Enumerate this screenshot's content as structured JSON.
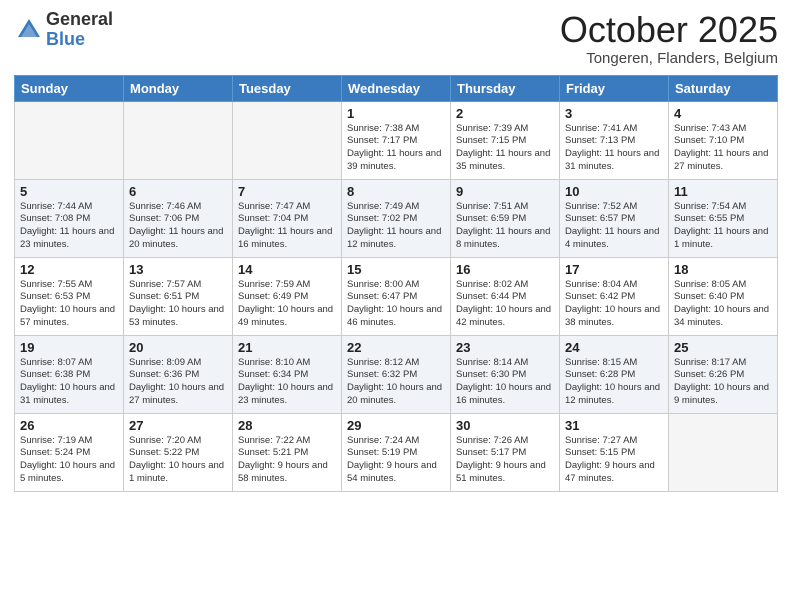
{
  "header": {
    "logo_general": "General",
    "logo_blue": "Blue",
    "month": "October 2025",
    "location": "Tongeren, Flanders, Belgium"
  },
  "days_of_week": [
    "Sunday",
    "Monday",
    "Tuesday",
    "Wednesday",
    "Thursday",
    "Friday",
    "Saturday"
  ],
  "weeks": [
    [
      {
        "day": "",
        "info": ""
      },
      {
        "day": "",
        "info": ""
      },
      {
        "day": "",
        "info": ""
      },
      {
        "day": "1",
        "info": "Sunrise: 7:38 AM\nSunset: 7:17 PM\nDaylight: 11 hours\nand 39 minutes."
      },
      {
        "day": "2",
        "info": "Sunrise: 7:39 AM\nSunset: 7:15 PM\nDaylight: 11 hours\nand 35 minutes."
      },
      {
        "day": "3",
        "info": "Sunrise: 7:41 AM\nSunset: 7:13 PM\nDaylight: 11 hours\nand 31 minutes."
      },
      {
        "day": "4",
        "info": "Sunrise: 7:43 AM\nSunset: 7:10 PM\nDaylight: 11 hours\nand 27 minutes."
      }
    ],
    [
      {
        "day": "5",
        "info": "Sunrise: 7:44 AM\nSunset: 7:08 PM\nDaylight: 11 hours\nand 23 minutes."
      },
      {
        "day": "6",
        "info": "Sunrise: 7:46 AM\nSunset: 7:06 PM\nDaylight: 11 hours\nand 20 minutes."
      },
      {
        "day": "7",
        "info": "Sunrise: 7:47 AM\nSunset: 7:04 PM\nDaylight: 11 hours\nand 16 minutes."
      },
      {
        "day": "8",
        "info": "Sunrise: 7:49 AM\nSunset: 7:02 PM\nDaylight: 11 hours\nand 12 minutes."
      },
      {
        "day": "9",
        "info": "Sunrise: 7:51 AM\nSunset: 6:59 PM\nDaylight: 11 hours\nand 8 minutes."
      },
      {
        "day": "10",
        "info": "Sunrise: 7:52 AM\nSunset: 6:57 PM\nDaylight: 11 hours\nand 4 minutes."
      },
      {
        "day": "11",
        "info": "Sunrise: 7:54 AM\nSunset: 6:55 PM\nDaylight: 11 hours\nand 1 minute."
      }
    ],
    [
      {
        "day": "12",
        "info": "Sunrise: 7:55 AM\nSunset: 6:53 PM\nDaylight: 10 hours\nand 57 minutes."
      },
      {
        "day": "13",
        "info": "Sunrise: 7:57 AM\nSunset: 6:51 PM\nDaylight: 10 hours\nand 53 minutes."
      },
      {
        "day": "14",
        "info": "Sunrise: 7:59 AM\nSunset: 6:49 PM\nDaylight: 10 hours\nand 49 minutes."
      },
      {
        "day": "15",
        "info": "Sunrise: 8:00 AM\nSunset: 6:47 PM\nDaylight: 10 hours\nand 46 minutes."
      },
      {
        "day": "16",
        "info": "Sunrise: 8:02 AM\nSunset: 6:44 PM\nDaylight: 10 hours\nand 42 minutes."
      },
      {
        "day": "17",
        "info": "Sunrise: 8:04 AM\nSunset: 6:42 PM\nDaylight: 10 hours\nand 38 minutes."
      },
      {
        "day": "18",
        "info": "Sunrise: 8:05 AM\nSunset: 6:40 PM\nDaylight: 10 hours\nand 34 minutes."
      }
    ],
    [
      {
        "day": "19",
        "info": "Sunrise: 8:07 AM\nSunset: 6:38 PM\nDaylight: 10 hours\nand 31 minutes."
      },
      {
        "day": "20",
        "info": "Sunrise: 8:09 AM\nSunset: 6:36 PM\nDaylight: 10 hours\nand 27 minutes."
      },
      {
        "day": "21",
        "info": "Sunrise: 8:10 AM\nSunset: 6:34 PM\nDaylight: 10 hours\nand 23 minutes."
      },
      {
        "day": "22",
        "info": "Sunrise: 8:12 AM\nSunset: 6:32 PM\nDaylight: 10 hours\nand 20 minutes."
      },
      {
        "day": "23",
        "info": "Sunrise: 8:14 AM\nSunset: 6:30 PM\nDaylight: 10 hours\nand 16 minutes."
      },
      {
        "day": "24",
        "info": "Sunrise: 8:15 AM\nSunset: 6:28 PM\nDaylight: 10 hours\nand 12 minutes."
      },
      {
        "day": "25",
        "info": "Sunrise: 8:17 AM\nSunset: 6:26 PM\nDaylight: 10 hours\nand 9 minutes."
      }
    ],
    [
      {
        "day": "26",
        "info": "Sunrise: 7:19 AM\nSunset: 5:24 PM\nDaylight: 10 hours\nand 5 minutes."
      },
      {
        "day": "27",
        "info": "Sunrise: 7:20 AM\nSunset: 5:22 PM\nDaylight: 10 hours\nand 1 minute."
      },
      {
        "day": "28",
        "info": "Sunrise: 7:22 AM\nSunset: 5:21 PM\nDaylight: 9 hours\nand 58 minutes."
      },
      {
        "day": "29",
        "info": "Sunrise: 7:24 AM\nSunset: 5:19 PM\nDaylight: 9 hours\nand 54 minutes."
      },
      {
        "day": "30",
        "info": "Sunrise: 7:26 AM\nSunset: 5:17 PM\nDaylight: 9 hours\nand 51 minutes."
      },
      {
        "day": "31",
        "info": "Sunrise: 7:27 AM\nSunset: 5:15 PM\nDaylight: 9 hours\nand 47 minutes."
      },
      {
        "day": "",
        "info": ""
      }
    ]
  ]
}
